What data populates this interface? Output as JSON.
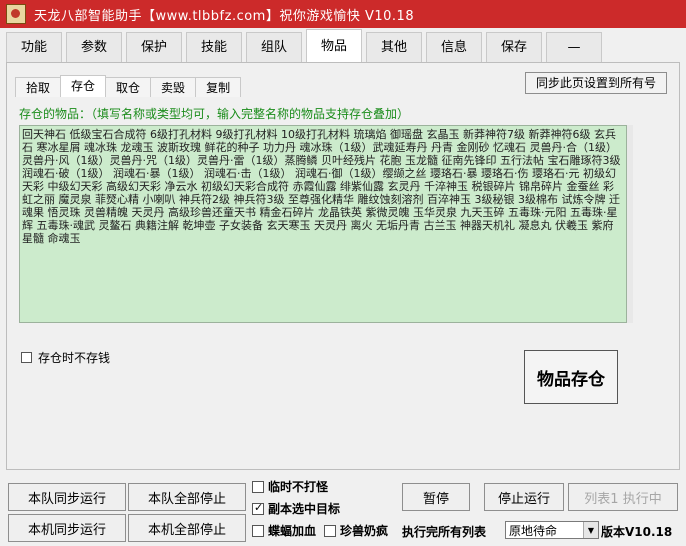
{
  "window": {
    "title": "天龙八部智能助手【www.tlbbfz.com】祝你游戏愉快 V10.18"
  },
  "main_tabs": [
    "功能",
    "参数",
    "保护",
    "技能",
    "组队",
    "物品",
    "其他",
    "信息",
    "保存",
    "—"
  ],
  "active_main_tab": "物品",
  "sub_tabs": [
    "拾取",
    "存仓",
    "取仓",
    "卖毁",
    "复制"
  ],
  "active_sub_tab": "存仓",
  "sync_button_label": "同步此页设置到所有号",
  "hint_text": "存仓的物品：（填写名称或类型均可，输入完整名称的物品支持存仓叠加）",
  "items_text": "回天神石 低级宝石合成符 6级打孔材料 9级打孔材料 10级打孔材料 琉璃焰 御瑶盘 玄晶玉 新莽神符7级 新莽神符6级 玄兵石 寒冰星屑 魂冰珠 龙魂玉 波斯玫瑰 鲜花的种子 功力丹 魂冰珠（1级）武魂延寿丹 丹青 金刚砂 忆魂石 灵兽丹·合（1级） 灵兽丹·风（1级）灵兽丹·咒（1级）灵兽丹·雷（1级）蒸腾鳞 贝叶经残片 花胞 玉龙髓 征南先锋印 五行法帖 宝石雕琢符3级 润魂石·破（1级） 润魂石·暴（1级） 润魂石·击（1级） 润魂石·御（1级）缨缬之丝 璎珞石·暴 璎珞石·伤 璎珞石·元 初级幻天彩 中级幻天彩 高级幻天彩 净云水 初级幻天彩合成符 赤霞仙露 绯紫仙露 玄灵丹 千淬神玉 税银碎片 锦帛碎片 金蚕丝 彩虹之丽 魔灵泉 菲燹心精 小喇叭 神兵符2级 神兵符3级 至尊强化精华 雕纹蚀刻溶剂 百淬神玉 3级秘银 3级棉布 试炼令牌 迁魂果 悟灵珠 灵兽精魄 天灵丹 高级珍兽还童天书 精金石碎片 龙晶铁英 紫微灵魄 玉华灵泉 九天玉碎 五毒珠·元阳 五毒珠·星辉 五毒珠·魂武 灵鳌石 典籍注解 乾坤壶 子女装备 玄天寒玉 天灵丹 离火 无垢丹青 古兰玉 神器天机礼 凝息丸 伏羲玉 紫府星髓 命魂玉",
  "no_store_checkbox_label": "存仓时不存钱",
  "no_store_checked": false,
  "store_button_label": "物品存仓",
  "bottom": {
    "team_sync_run": "本队同步运行",
    "team_all_stop": "本队全部停止",
    "local_sync_run": "本机同步运行",
    "local_all_stop": "本机全部停止",
    "temp_no_fight": "临时不打怪",
    "temp_no_fight_checked": false,
    "dungeon_select_target": "副本选中目标",
    "dungeon_select_target_checked": true,
    "mantis_heal": "蝶蝠加血",
    "mantis_heal_checked": false,
    "pet_milk": "珍兽奶疯",
    "pet_milk_checked": false,
    "pause": "暂停",
    "stop_run": "停止运行",
    "list_exec": "列表1 执行中",
    "after_list_label": "执行完所有列表",
    "after_list_value": "原地待命",
    "version": "版本V10.18"
  }
}
